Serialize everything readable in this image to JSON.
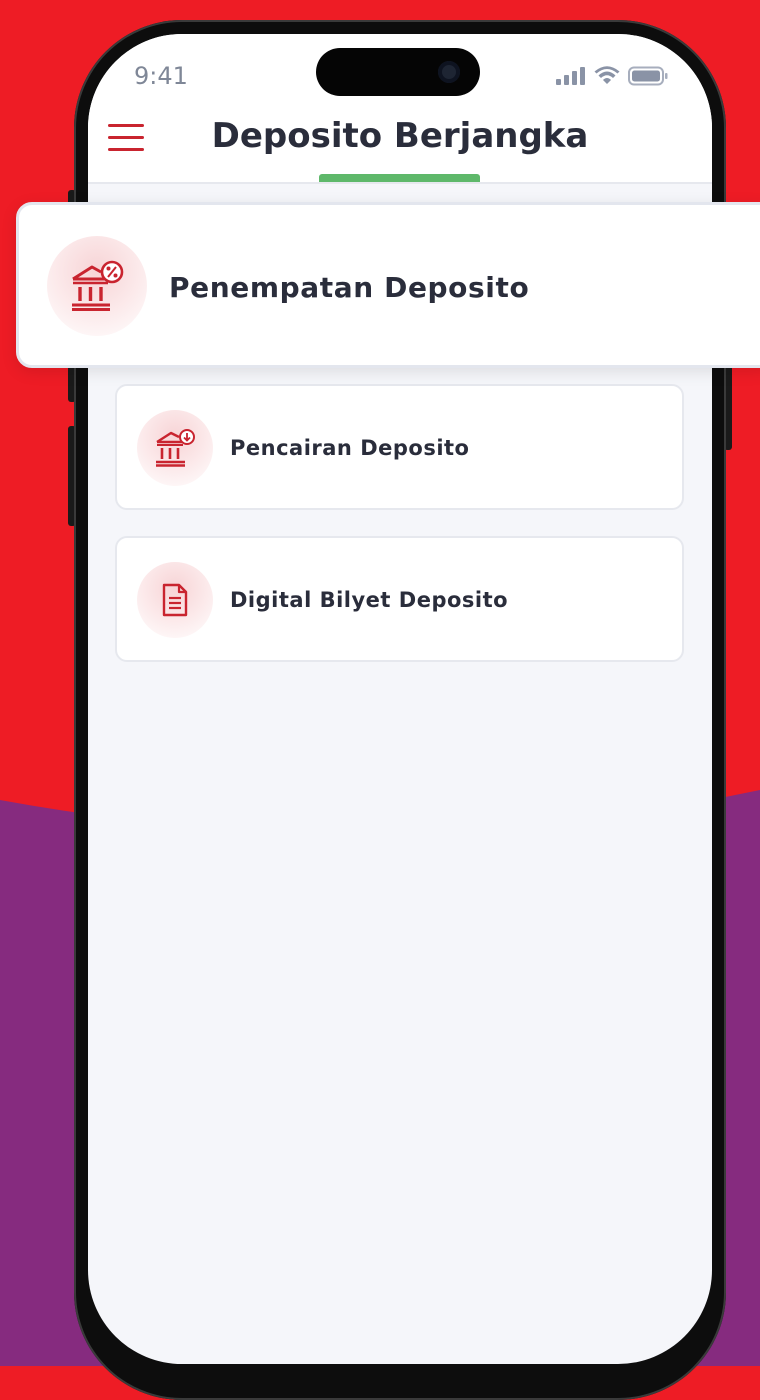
{
  "status_bar": {
    "time": "9:41"
  },
  "header": {
    "title": "Deposito Berjangka"
  },
  "menu": [
    {
      "label": "Penempatan Deposito",
      "icon": "bank-percent-icon"
    },
    {
      "label": "Pencairan Deposito",
      "icon": "bank-withdraw-icon"
    },
    {
      "label": "Digital Bilyet Deposito",
      "icon": "document-icon"
    }
  ],
  "colors": {
    "background_red": "#EE1C25",
    "background_purple": "#862B7F",
    "accent_red": "#C9242F",
    "tab_indicator_green": "#5EB86A",
    "text_dark": "#2A2D3B"
  }
}
